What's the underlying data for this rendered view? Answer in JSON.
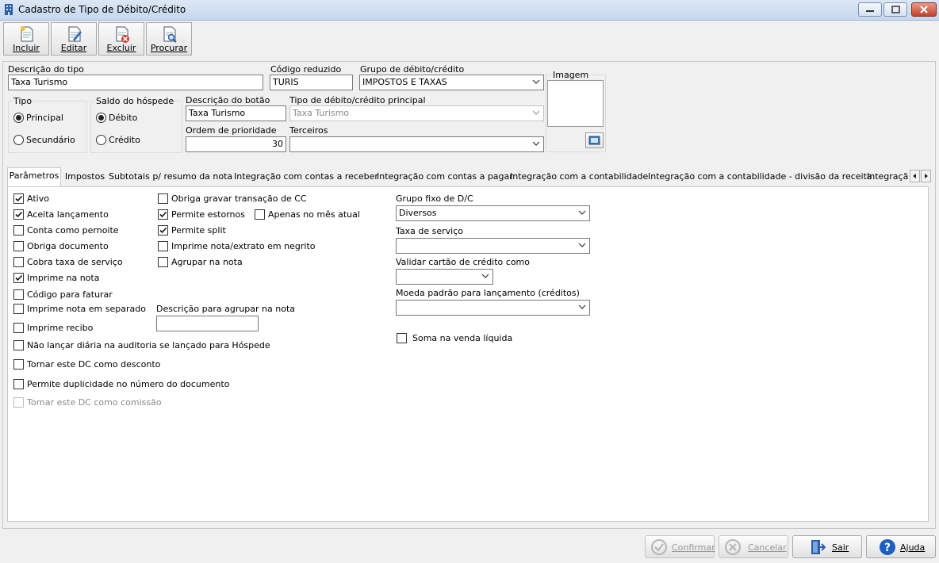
{
  "window": {
    "title": "Cadastro de Tipo de Débito/Crédito"
  },
  "toolbar": {
    "incluir": "Incluir",
    "editar": "Editar",
    "excluir": "Excluir",
    "procurar": "Procurar"
  },
  "form": {
    "descricao_tipo": {
      "label": "Descrição do tipo",
      "value": "Taxa Turismo"
    },
    "codigo_reduzido": {
      "label": "Código reduzido",
      "value": "TURIS"
    },
    "grupo": {
      "label": "Grupo de débito/crédito",
      "value": "IMPOSTOS E TAXAS"
    },
    "imagem": {
      "label": "Imagem"
    },
    "tipo": {
      "label": "Tipo",
      "options": [
        "Principal",
        "Secundário"
      ],
      "selected": "Principal"
    },
    "saldo": {
      "label": "Saldo do hóspede",
      "options": [
        "Débito",
        "Crédito"
      ],
      "selected": "Débito"
    },
    "descricao_botao": {
      "label": "Descrição do botão",
      "value": "Taxa Turismo"
    },
    "tipo_principal": {
      "label": "Tipo de débito/crédito principal",
      "value": "Taxa Turismo"
    },
    "ordem": {
      "label": "Ordem de prioridade",
      "value": "30"
    },
    "terceiros": {
      "label": "Terceiros",
      "value": ""
    }
  },
  "tabs": [
    "Parâmetros",
    "Impostos",
    "Subtotais p/ resumo da nota",
    "Integração com contas a receber",
    "Integração com contas a pagar",
    "Integração com a contabilidade",
    "Integração com a contabilidade - divisão da receita",
    "Integraçã"
  ],
  "params": {
    "col1": [
      {
        "label": "Ativo",
        "checked": true
      },
      {
        "label": "Aceita lançamento",
        "checked": true
      },
      {
        "label": "Conta como pernoite",
        "checked": false
      },
      {
        "label": "Obriga documento",
        "checked": false
      },
      {
        "label": "Cobra taxa de serviço",
        "checked": false
      },
      {
        "label": "Imprime na nota",
        "checked": true
      },
      {
        "label": "Código para faturar",
        "checked": false
      },
      {
        "label": "Imprime nota em separado",
        "checked": false
      },
      {
        "label": "Imprime recibo",
        "checked": false
      },
      {
        "label": "Não lançar diária na auditoria se lançado para Hóspede",
        "checked": false
      },
      {
        "label": "Tornar este DC como desconto",
        "checked": false
      },
      {
        "label": "Permite duplicidade no número do documento",
        "checked": false
      },
      {
        "label": "Tornar este DC como comissão",
        "checked": false,
        "disabled": true
      }
    ],
    "col2": [
      {
        "label": "Obriga gravar transação de CC",
        "checked": false
      },
      {
        "label": "Permite estornos",
        "checked": true
      },
      {
        "label": "Permite split",
        "checked": true
      },
      {
        "label": "Imprime nota/extrato em negrito",
        "checked": false
      },
      {
        "label": "Agrupar na nota",
        "checked": false
      }
    ],
    "apenas_mes": {
      "label": "Apenas no mês atual",
      "checked": false
    },
    "descricao_agrupar": {
      "label": "Descrição para agrupar na nota",
      "value": ""
    },
    "grupo_fixo": {
      "label": "Grupo fixo de D/C",
      "value": "Diversos"
    },
    "taxa_servico": {
      "label": "Taxa de serviço",
      "value": ""
    },
    "validar_cartao": {
      "label": "Validar cartão de crédito como",
      "value": ""
    },
    "moeda": {
      "label": "Moeda padrão para lançamento (créditos)",
      "value": ""
    },
    "soma_venda": {
      "label": "Soma na venda líquida",
      "checked": false
    }
  },
  "footer": {
    "confirmar": "Confirmar",
    "cancelar": "Cancelar",
    "sair": "Sair",
    "ajuda": "Ajuda"
  }
}
